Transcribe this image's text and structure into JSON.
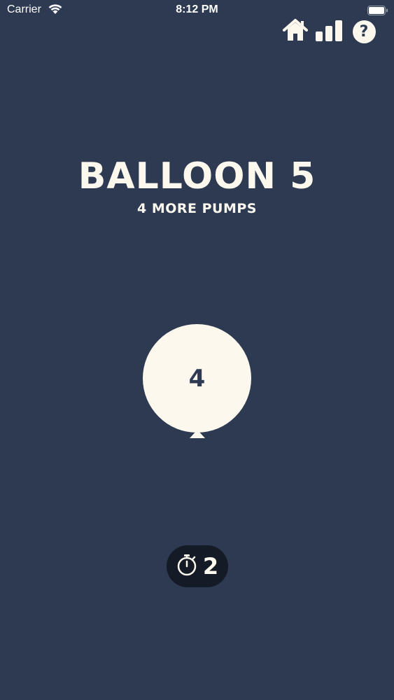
{
  "status_bar": {
    "carrier": "Carrier",
    "time": "8:12 PM"
  },
  "toolbar": {
    "home_icon": "home-icon",
    "stats_icon": "bar-chart-icon",
    "help_icon": "question-icon",
    "help_glyph": "?"
  },
  "game": {
    "title": "BALLOON 5",
    "subtitle": "4 MORE PUMPS",
    "balloon_count": "4",
    "timer_icon": "stopwatch-icon",
    "timer_value": "2"
  },
  "colors": {
    "background": "#2d3a52",
    "cream": "#fdf8ee",
    "pill": "#151b26"
  }
}
